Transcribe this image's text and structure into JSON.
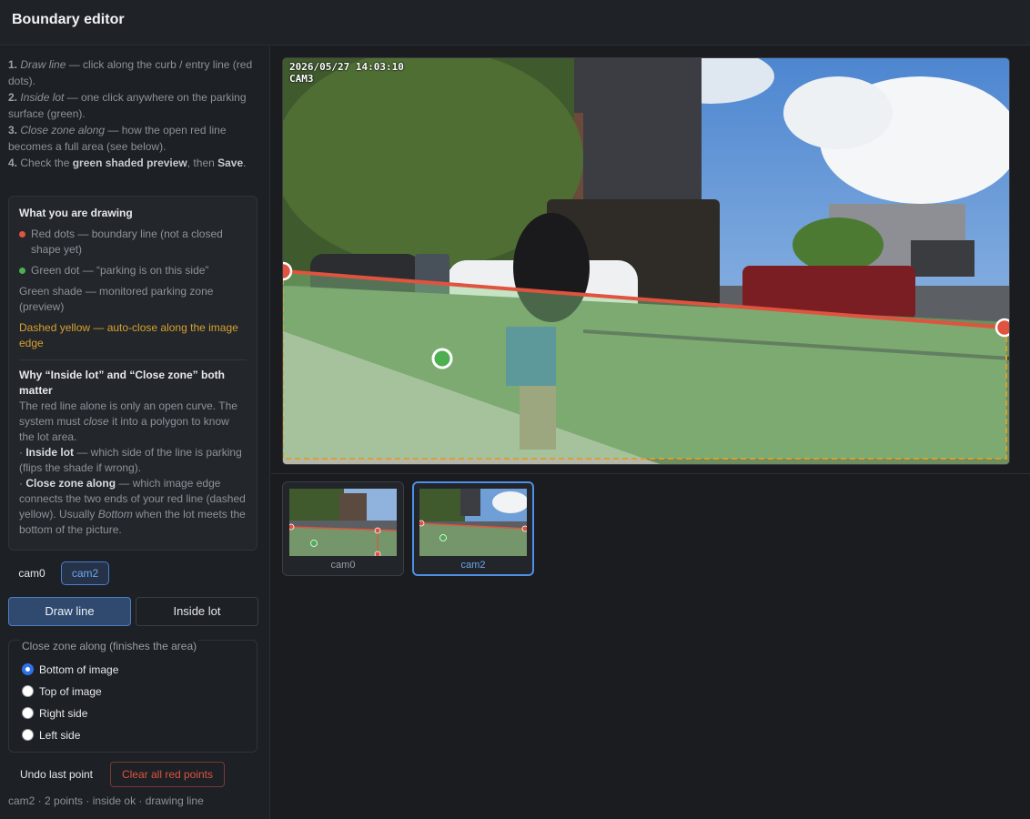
{
  "app": {
    "title": "Boundary editor"
  },
  "steps": {
    "s1_num": "1.",
    "s1_em": "Draw line",
    "s1_rest": " — click along the curb / entry line (red dots).",
    "s2_num": "2.",
    "s2_em": "Inside lot",
    "s2_rest": " — one click anywhere on the parking surface (green).",
    "s3_num": "3.",
    "s3_em": "Close zone along",
    "s3_rest": " — how the open red line becomes a full area (see below).",
    "s4_num": "4.",
    "s4_pre": " Check the ",
    "s4_strong": "green shaded preview",
    "s4_mid": ", then ",
    "s4_save": "Save",
    "s4_end": "."
  },
  "info": {
    "heading": "What you are drawing",
    "red": "Red dots — boundary line (not a closed shape yet)",
    "green": "Green dot — “parking is on this side”",
    "shade": "Green shade — monitored parking zone (preview)",
    "dashed": "Dashed yellow — auto-close along the image edge",
    "why_heading": "Why “Inside lot” and “Close zone” both matter",
    "why_p1": "The red line alone is only an open curve. The system must ",
    "why_p1_em": "close",
    "why_p1_end": " it into a polygon to know the lot area.",
    "b1_pre": "· ",
    "b1_label": "Inside lot",
    "b1_text": " — which side of the line is parking (flips the shade if wrong).",
    "b2_pre": "· ",
    "b2_label": "Close zone along",
    "b2_text": " — which image edge connects the two ends of your red line (dashed yellow). Usually ",
    "b2_em": "Bottom",
    "b2_end": " when the lot meets the bottom of the picture."
  },
  "cameras": {
    "tab0": "cam0",
    "tab2": "cam2",
    "active": "cam2"
  },
  "modes": {
    "draw": "Draw line",
    "inside": "Inside lot",
    "active": "draw"
  },
  "close_zone": {
    "legend": "Close zone along (finishes the area)",
    "options": [
      "Bottom of image",
      "Top of image",
      "Right side",
      "Left side"
    ],
    "selected": "Bottom of image"
  },
  "actions": {
    "undo": "Undo last point",
    "clear": "Clear all red points"
  },
  "status": "cam2 · 2 points · inside ok · drawing line",
  "viewer": {
    "timestamp": "2026/05/27 14:03:10",
    "camera_label": "CAM3"
  },
  "thumbnails": [
    {
      "label": "cam0"
    },
    {
      "label": "cam2"
    }
  ],
  "colors": {
    "boundary": "#e0533f",
    "inside_dot": "#4caf50",
    "zone_fill": "#8fd18a",
    "close_edge": "#d6a12e",
    "accent": "#4f8fe6"
  },
  "icons": {
    "boundary_point": "red-circle",
    "inside_point": "green-circle"
  }
}
